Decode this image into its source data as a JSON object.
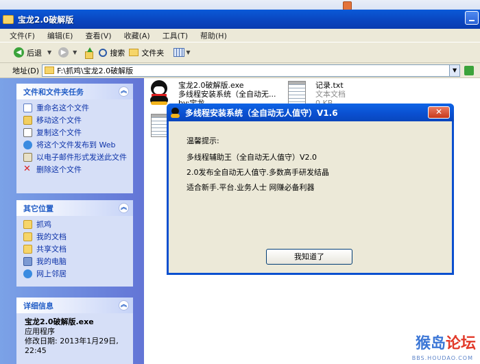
{
  "window": {
    "title": "宝龙2.0破解版"
  },
  "menu": [
    "文件(F)",
    "编辑(E)",
    "查看(V)",
    "收藏(A)",
    "工具(T)",
    "帮助(H)"
  ],
  "toolbar": {
    "back": "后退",
    "search": "搜索",
    "folders": "文件夹"
  },
  "address": {
    "label": "地址(D)",
    "path": "F:\\抓鸡\\宝龙2.0破解版"
  },
  "tasks": {
    "title": "文件和文件夹任务",
    "items": [
      "重命名这个文件",
      "移动这个文件",
      "复制这个文件",
      "将这个文件发布到 Web",
      "以电子邮件形式发送此文件",
      "删除这个文件"
    ]
  },
  "places": {
    "title": "其它位置",
    "items": [
      "抓鸡",
      "我的文档",
      "共享文档",
      "我的电脑",
      "网上邻居"
    ]
  },
  "details": {
    "title": "详细信息",
    "name": "宝龙2.0破解版.exe",
    "type": "应用程序",
    "modified_label": "修改日期: 2013年1月29日,",
    "modified_time": "22:45"
  },
  "files": [
    {
      "name": "宝龙2.0破解版.exe",
      "desc": "多线程安装系统（全自动无...",
      "extra": "by:宝龙"
    },
    {
      "name": "记录.txt",
      "desc": "文本文档",
      "extra": "0 KB"
    }
  ],
  "dialog": {
    "title": "多线程安装系统（全自动无人值守）V1.6",
    "heading": "温馨提示:",
    "line1": "多线程辅助王（全自动无人值守）V2.0",
    "line2": "2.0发布全自动无人值守.多数高手研发结晶",
    "line3": "适合新手.平台.业务人士 网赚必备利器",
    "ok": "我知道了",
    "close": "✕"
  },
  "watermark": {
    "part1": "猴岛",
    "part2": "论坛",
    "url": "BBS.HOUDAO.COM"
  },
  "colors": {
    "title_bar": "#0a4fcf",
    "task_pane": "#7ba2e7",
    "link": "#0c32a8"
  }
}
